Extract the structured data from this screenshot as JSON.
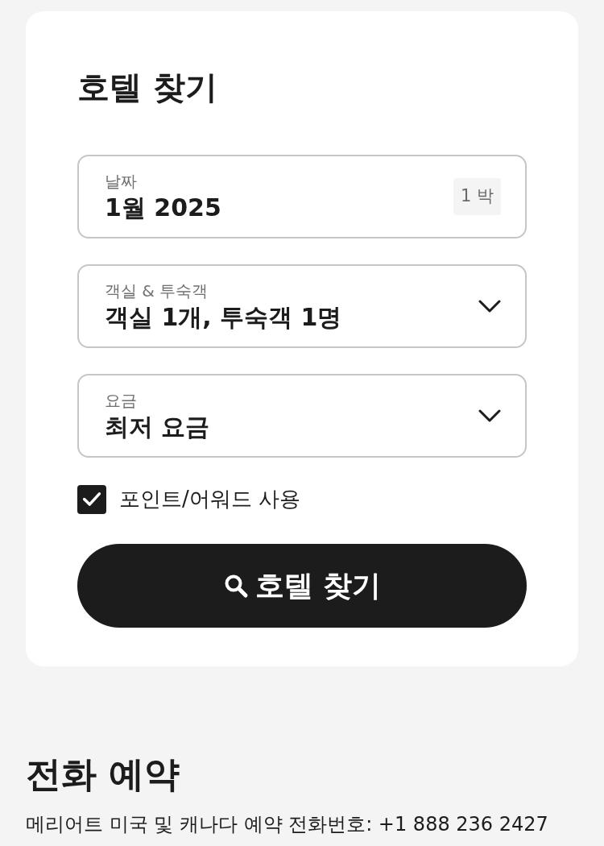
{
  "search_card": {
    "title": "호텔 찾기",
    "fields": [
      {
        "kind": "dates",
        "label": "날짜",
        "value": "1월 2025",
        "badge": "1 박"
      },
      {
        "kind": "dropdown",
        "label": "객실 & 투숙객",
        "value": "객실 1개, 투숙객 1명"
      },
      {
        "kind": "dropdown",
        "label": "요금",
        "value": "최저 요금"
      }
    ],
    "points_checkbox": {
      "label": "포인트/어워드 사용",
      "checked": true
    },
    "search_button": {
      "label": "호텔 찾기"
    }
  },
  "phone_booking": {
    "title": "전화 예약",
    "text": "메리어트 미국 및 캐나다 예약 전화번호: +1 888 236 2427"
  }
}
